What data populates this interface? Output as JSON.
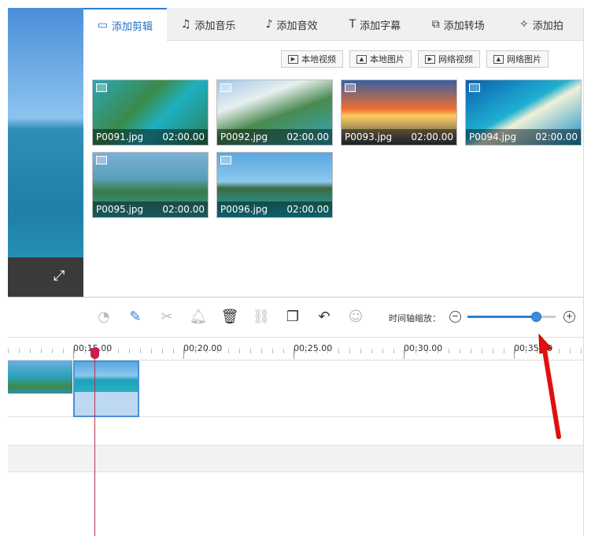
{
  "tabs": [
    {
      "label": "添加剪辑",
      "icon": "video-camera-icon",
      "glyph": "▭"
    },
    {
      "label": "添加音乐",
      "icon": "music-note-icon",
      "glyph": "♫"
    },
    {
      "label": "添加音效",
      "icon": "sound-effect-icon",
      "glyph": "♪"
    },
    {
      "label": "添加字幕",
      "icon": "text-icon",
      "glyph": "T"
    },
    {
      "label": "添加转场",
      "icon": "transition-icon",
      "glyph": "⧉"
    },
    {
      "label": "添加拍",
      "icon": "magic-wand-icon",
      "glyph": "✧"
    }
  ],
  "source_buttons": [
    {
      "label": "本地视频",
      "glyph": "▶"
    },
    {
      "label": "本地图片",
      "glyph": "▲"
    },
    {
      "label": "网络视频",
      "glyph": "▶"
    },
    {
      "label": "网络图片",
      "glyph": "▲"
    }
  ],
  "media": [
    {
      "name": "P0091.jpg",
      "duration": "02:00.00"
    },
    {
      "name": "P0092.jpg",
      "duration": "02:00.00"
    },
    {
      "name": "P0093.jpg",
      "duration": "02:00.00"
    },
    {
      "name": "P0094.jpg",
      "duration": "02:00.00"
    },
    {
      "name": "P0095.jpg",
      "duration": "02:00.00"
    },
    {
      "name": "P0096.jpg",
      "duration": "02:00.00"
    }
  ],
  "toolbar": {
    "tools": [
      {
        "name": "speed-icon",
        "glyph": "◔"
      },
      {
        "name": "pencil-icon",
        "glyph": "✎"
      },
      {
        "name": "scissors-icon",
        "glyph": "✂"
      },
      {
        "name": "bell-icon",
        "glyph": "🔔︎"
      },
      {
        "name": "trash-icon",
        "glyph": "🗑︎"
      },
      {
        "name": "unlink-icon",
        "glyph": "⛓"
      },
      {
        "name": "copy-icon",
        "glyph": "❐"
      },
      {
        "name": "undo-icon",
        "glyph": "↶"
      },
      {
        "name": "emoji-icon",
        "glyph": "☺"
      }
    ],
    "zoom_label": "时间轴缩放：",
    "zoom_minus": "−",
    "zoom_plus": "+",
    "zoom_level": 0.78
  },
  "ruler": [
    "00:15.00",
    "00:20.00",
    "00:25.00",
    "00:30.00",
    "00:35.00"
  ],
  "expand_glyph": "⤢"
}
